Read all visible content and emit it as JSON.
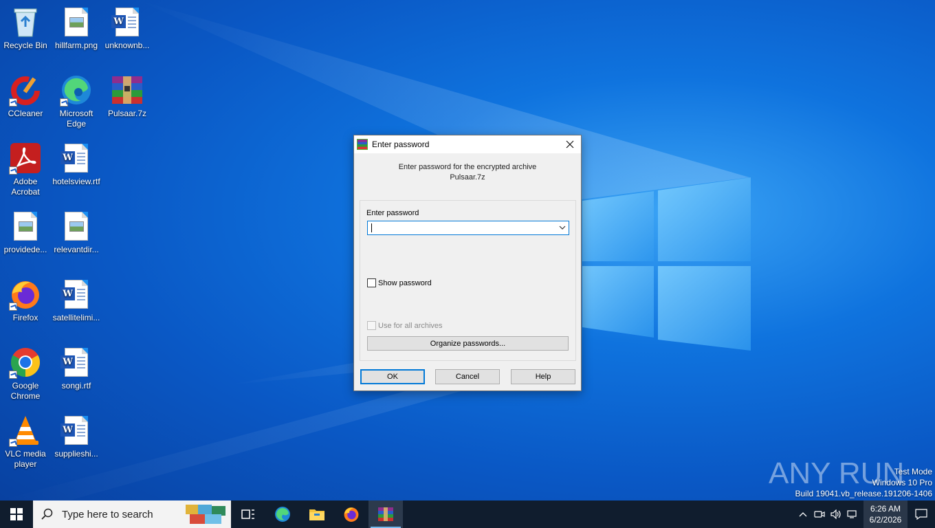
{
  "desktop": {
    "icons": [
      {
        "label": "Recycle Bin",
        "icon": "recycle-bin-icon"
      },
      {
        "label": "hillfarm.png",
        "icon": "image-file-icon"
      },
      {
        "label": "unknownb...",
        "icon": "word-document-icon"
      },
      {
        "label": "CCleaner",
        "icon": "ccleaner-icon"
      },
      {
        "label": "Microsoft Edge",
        "icon": "edge-icon"
      },
      {
        "label": "Pulsaar.7z",
        "icon": "winrar-archive-icon"
      },
      {
        "label": "Adobe Acrobat",
        "icon": "acrobat-icon"
      },
      {
        "label": "hotelsview.rtf",
        "icon": "word-document-icon"
      },
      {
        "label": "providede...",
        "icon": "image-file-icon"
      },
      {
        "label": "relevantdir...",
        "icon": "image-file-icon"
      },
      {
        "label": "Firefox",
        "icon": "firefox-icon"
      },
      {
        "label": "satellitelimi...",
        "icon": "word-document-icon"
      },
      {
        "label": "Google Chrome",
        "icon": "chrome-icon"
      },
      {
        "label": "songi.rtf",
        "icon": "word-document-icon"
      },
      {
        "label": "VLC media player",
        "icon": "vlc-icon"
      },
      {
        "label": "supplieshi...",
        "icon": "word-document-icon"
      }
    ]
  },
  "dialog": {
    "title": "Enter password",
    "prompt_line1": "Enter password for the encrypted archive",
    "prompt_line2": "Pulsaar.7z",
    "field_label": "Enter password",
    "password_value": "",
    "show_password_label": "Show password",
    "use_all_label": "Use for all archives",
    "organize_label": "Organize passwords...",
    "ok_label": "OK",
    "cancel_label": "Cancel",
    "help_label": "Help"
  },
  "watermark": {
    "text": "ANY RUN"
  },
  "system_info": {
    "line1": "Test Mode",
    "line2": "Windows 10 Pro",
    "line3": "Build 19041.vb_release.191206-1406"
  },
  "taskbar": {
    "search_placeholder": "Type here to search",
    "time": "6:26 AM",
    "date": "6/2/2026"
  },
  "colors": {
    "accent": "#0078d7",
    "taskbar_bg": "#101d2e",
    "desktop_blue": "#0a58c5"
  }
}
